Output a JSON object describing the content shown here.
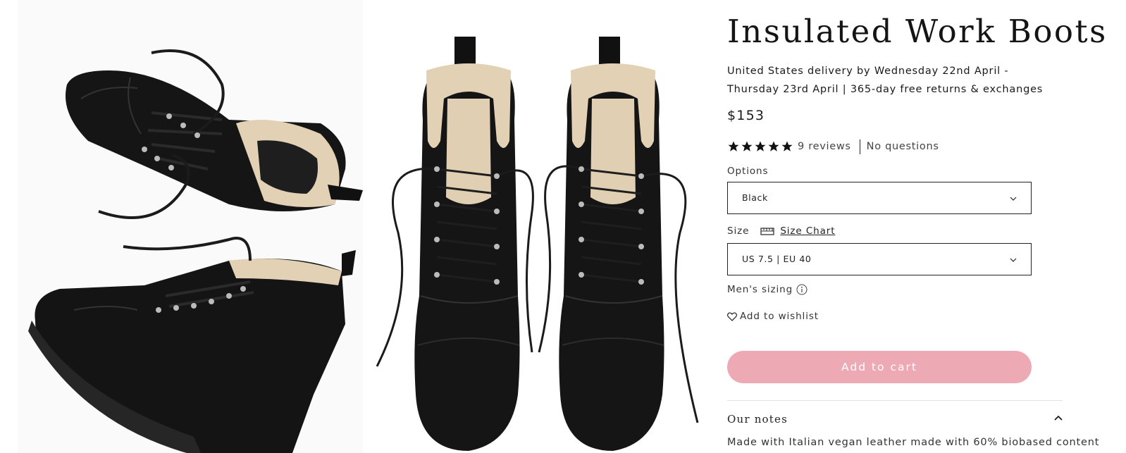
{
  "product": {
    "title": "Insulated Work Boots",
    "delivery_text": "United States delivery by Wednesday 22nd April - Thursday 23rd April | 365-day free returns & exchanges",
    "price": "$153",
    "rating": 5,
    "reviews_label": "9 reviews",
    "questions_label": "No questions"
  },
  "options": {
    "label": "Options",
    "selected": "Black"
  },
  "size": {
    "label": "Size",
    "chart_link": "Size Chart",
    "selected": "US 7.5 | EU 40",
    "sizing_note": "Men's sizing"
  },
  "actions": {
    "wishlist_label": "Add to wishlist",
    "add_to_cart_label": "Add to cart"
  },
  "notes": {
    "title": "Our notes",
    "body": "Made with Italian vegan leather made with 60% biobased content"
  },
  "gallery": {
    "images": [
      {
        "name": "boots-top-view-image"
      },
      {
        "name": "boots-front-view-image"
      }
    ]
  },
  "colors": {
    "accent": "#eda9b4",
    "text": "#1a1a1a",
    "border": "#222222"
  }
}
